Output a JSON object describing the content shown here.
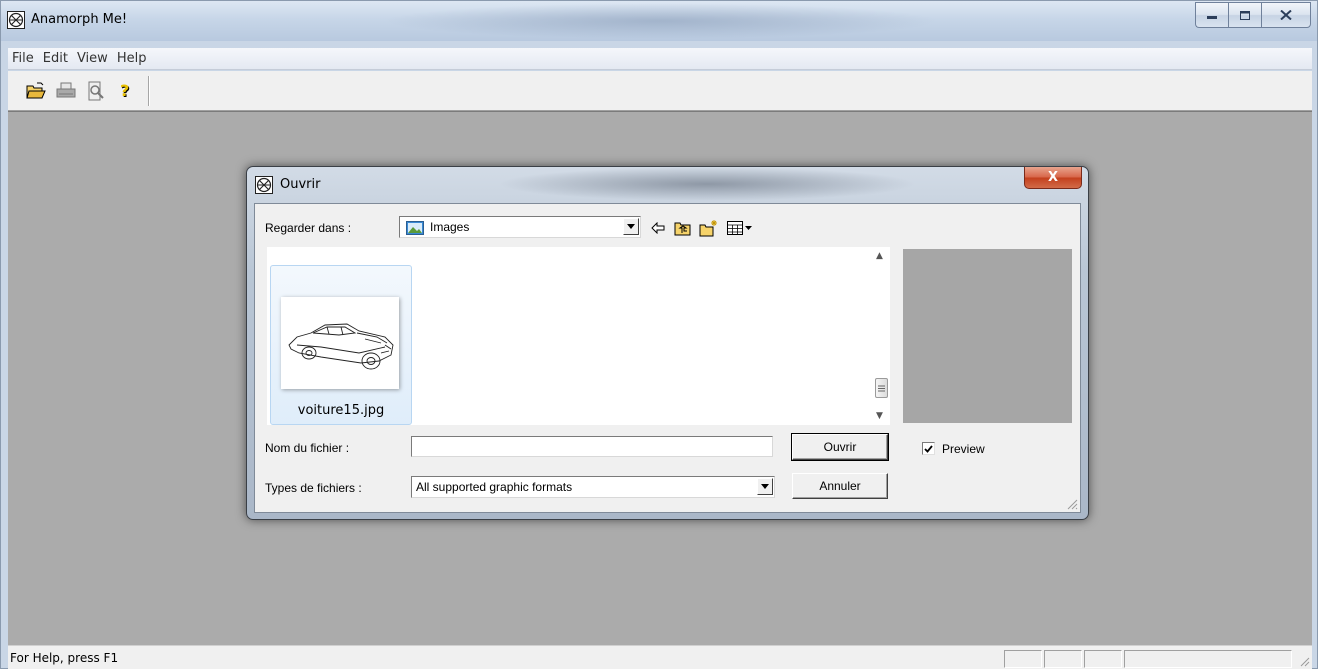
{
  "window": {
    "title": "Anamorph Me!",
    "buttons": {
      "minimize": "minimize",
      "maximize": "maximize",
      "close": "close"
    }
  },
  "menubar": {
    "items": [
      "File",
      "Edit",
      "View",
      "Help"
    ]
  },
  "toolbar": {
    "buttons": [
      {
        "icon": "open-folder-icon",
        "enabled": true
      },
      {
        "icon": "print-icon",
        "enabled": false
      },
      {
        "icon": "print-preview-icon",
        "enabled": false
      },
      {
        "icon": "help-icon",
        "enabled": true
      }
    ]
  },
  "statusbar": {
    "text": "For Help, press F1"
  },
  "dialog": {
    "title": "Ouvrir",
    "close_label": "X",
    "look_in_label": "Regarder dans :",
    "look_in_value": "Images",
    "files": [
      {
        "name": "voiture15.jpg",
        "thumbnail": "car-sketch"
      }
    ],
    "filename_label": "Nom du fichier :",
    "filename_value": "",
    "filetype_label": "Types de fichiers :",
    "filetype_value": "All supported graphic formats",
    "open_button": "Ouvrir",
    "cancel_button": "Annuler",
    "preview_label": "Preview",
    "preview_checked": true
  },
  "colors": {
    "client_bg": "#ababab",
    "preview_bg": "#a6a6a6",
    "close_red": "#c3401e",
    "selection": "#dfedfa"
  }
}
